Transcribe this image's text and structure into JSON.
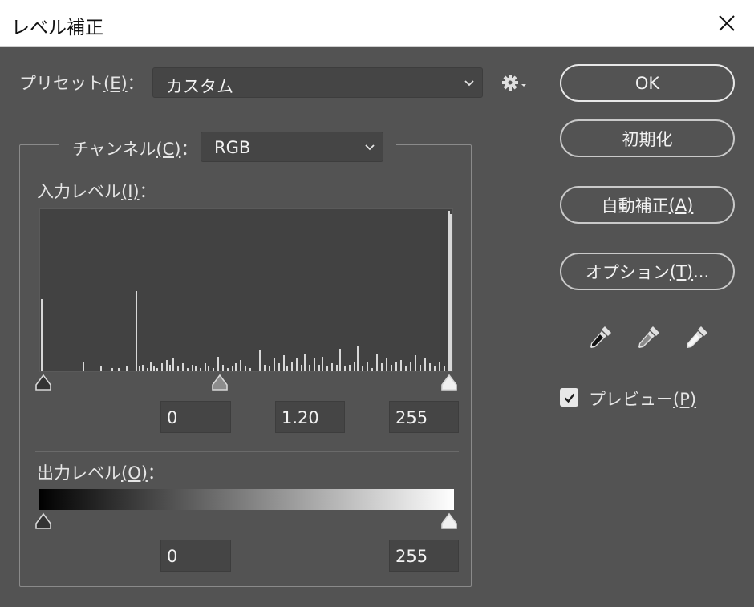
{
  "window": {
    "title": "レベル補正",
    "close_icon": "close-icon"
  },
  "preset": {
    "label": "プリセット",
    "mnemonic": "(E)",
    "colon": "：",
    "value": "カスタム"
  },
  "channel": {
    "label": "チャンネル",
    "mnemonic": "(C)",
    "colon": "：",
    "value": "RGB"
  },
  "input_levels": {
    "label": "入力レベル",
    "mnemonic": "(I)",
    "colon": "：",
    "shadow": "0",
    "gamma": "1.20",
    "highlight": "255"
  },
  "output_levels": {
    "label": "出力レベル",
    "mnemonic": "(O)",
    "colon": "：",
    "shadow": "0",
    "highlight": "255"
  },
  "buttons": {
    "ok": "OK",
    "reset": "初期化",
    "auto": "自動補正",
    "auto_mnemonic": "(A)",
    "options": "オプション",
    "options_mnemonic": "(T)",
    "options_suffix": "..."
  },
  "preview": {
    "label": "プレビュー",
    "mnemonic": "(P)",
    "checked": true
  },
  "icons": [
    "gear-icon",
    "black-eyedropper-icon",
    "gray-eyedropper-icon",
    "white-eyedropper-icon",
    "checkmark-icon",
    "chevron-down-icon"
  ],
  "colors": {
    "panel": "#535353",
    "field": "#454545",
    "histogram_bg": "#424242",
    "histogram_bar": "#d8d8d8"
  },
  "histogram": [
    [
      0,
      0.45
    ],
    [
      26,
      0.06
    ],
    [
      37,
      0.03
    ],
    [
      44,
      0.02
    ],
    [
      48,
      0.02
    ],
    [
      53,
      0.03
    ],
    [
      59,
      0.5
    ],
    [
      61,
      0.03
    ],
    [
      63,
      0.04
    ],
    [
      66,
      0.02
    ],
    [
      68,
      0.06
    ],
    [
      70,
      0.03
    ],
    [
      72,
      0.02
    ],
    [
      75,
      0.05
    ],
    [
      78,
      0.07
    ],
    [
      80,
      0.04
    ],
    [
      82,
      0.08
    ],
    [
      85,
      0.03
    ],
    [
      88,
      0.05
    ],
    [
      91,
      0.02
    ],
    [
      94,
      0.04
    ],
    [
      96,
      0.03
    ],
    [
      99,
      0.02
    ],
    [
      102,
      0.05
    ],
    [
      104,
      0.03
    ],
    [
      107,
      0.02
    ],
    [
      110,
      0.09
    ],
    [
      113,
      0.04
    ],
    [
      116,
      0.02
    ],
    [
      119,
      0.03
    ],
    [
      121,
      0.05
    ],
    [
      124,
      0.07
    ],
    [
      127,
      0.03
    ],
    [
      130,
      0.02
    ],
    [
      136,
      0.13
    ],
    [
      139,
      0.04
    ],
    [
      142,
      0.03
    ],
    [
      145,
      0.08
    ],
    [
      148,
      0.05
    ],
    [
      151,
      0.1
    ],
    [
      153,
      0.03
    ],
    [
      156,
      0.06
    ],
    [
      159,
      0.08
    ],
    [
      162,
      0.04
    ],
    [
      164,
      0.11
    ],
    [
      167,
      0.04
    ],
    [
      170,
      0.08
    ],
    [
      173,
      0.04
    ],
    [
      175,
      0.09
    ],
    [
      178,
      0.03
    ],
    [
      181,
      0.05
    ],
    [
      184,
      0.04
    ],
    [
      186,
      0.14
    ],
    [
      189,
      0.03
    ],
    [
      192,
      0.04
    ],
    [
      195,
      0.06
    ],
    [
      197,
      0.16
    ],
    [
      200,
      0.03
    ],
    [
      203,
      0.06
    ],
    [
      206,
      0.02
    ],
    [
      209,
      0.11
    ],
    [
      212,
      0.05
    ],
    [
      215,
      0.08
    ],
    [
      218,
      0.04
    ],
    [
      221,
      0.06
    ],
    [
      224,
      0.07
    ],
    [
      227,
      0.03
    ],
    [
      230,
      0.06
    ],
    [
      233,
      0.1
    ],
    [
      236,
      0.04
    ],
    [
      239,
      0.08
    ],
    [
      242,
      0.05
    ],
    [
      245,
      0.03
    ],
    [
      248,
      0.06
    ],
    [
      251,
      0.03
    ],
    [
      254,
      1.0
    ],
    [
      255,
      0.98
    ]
  ]
}
